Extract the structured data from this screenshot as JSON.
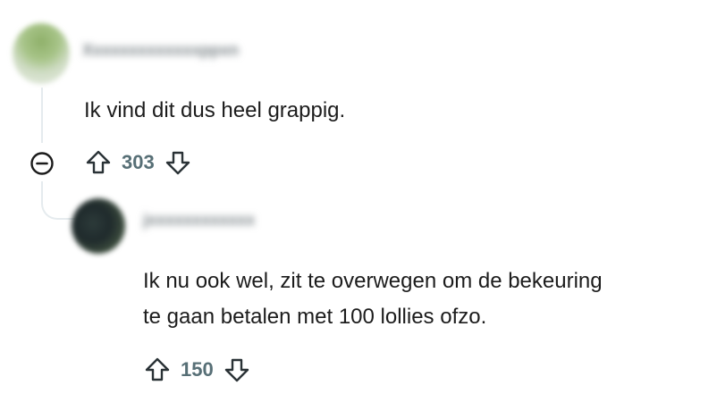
{
  "comments": [
    {
      "username": "Xxxxxxxxxxxxxppxn",
      "text": "Ik vind dit dus heel grappig.",
      "score": "303",
      "upvote_icon": "arrow-up-icon",
      "downvote_icon": "arrow-down-icon"
    },
    {
      "username": "jxxxxxxxxxxxx",
      "text_lines": [
        "Ik nu ook wel, zit te overwegen om de bekeuring",
        "te gaan betalen met 100 lollies ofzo."
      ],
      "score": "150",
      "upvote_icon": "arrow-up-icon",
      "downvote_icon": "arrow-down-icon"
    }
  ],
  "thread": {
    "collapse_icon": "minus-circle-icon"
  }
}
